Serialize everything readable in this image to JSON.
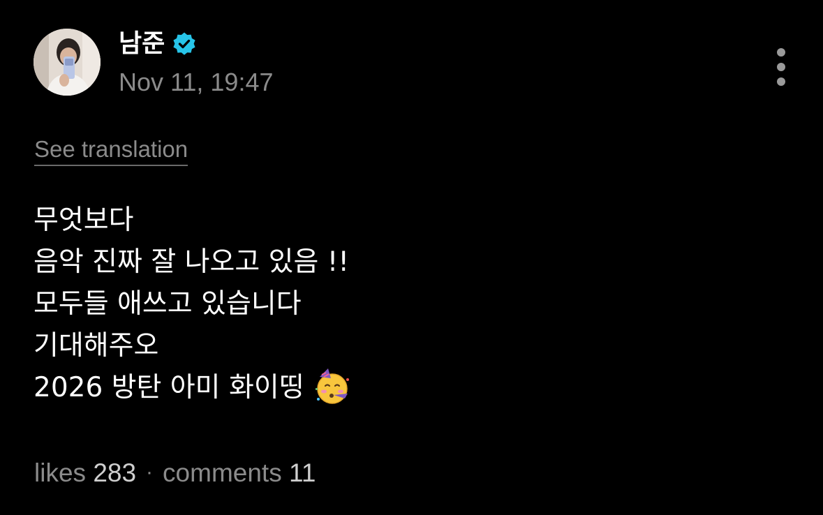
{
  "post": {
    "author_name": "남준",
    "verified_icon": "verified-badge-icon",
    "timestamp": "Nov 11, 19:47",
    "see_translation": "See translation",
    "lines": [
      "무엇보다",
      "음악 진짜 잘 나오고 있음 !!",
      "모두들 애쓰고 있습니다",
      "기대해주오",
      "2026 방탄 아미 화이띵"
    ],
    "emoji": "partying-face-icon"
  },
  "stats": {
    "likes_label": "likes",
    "likes_count": "283",
    "separator": "·",
    "comments_label": "comments",
    "comments_count": "11"
  },
  "colors": {
    "background": "#000000",
    "text_primary": "#ffffff",
    "text_secondary": "#8b8b8b",
    "verified": "#27c4e8"
  }
}
